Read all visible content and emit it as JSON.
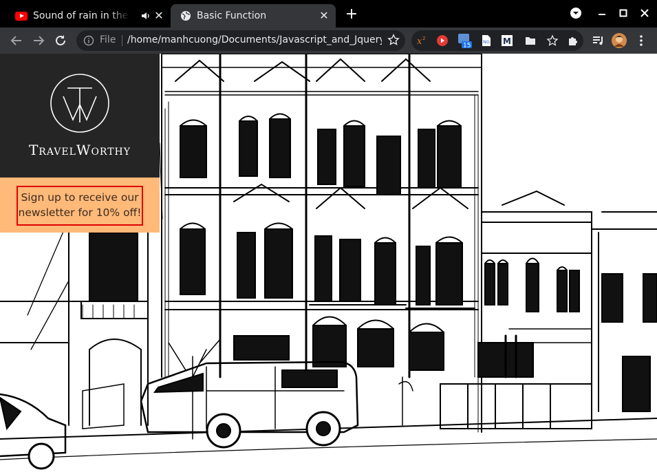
{
  "browser": {
    "tabs": [
      {
        "title": "Sound of rain in the dee",
        "favicon": "youtube-icon",
        "audio": "speaker-icon",
        "active": false
      },
      {
        "title": "Basic Function",
        "favicon": "globe-icon",
        "active": true
      }
    ],
    "address": {
      "scheme_label": "File",
      "url": "/home/manhcuong/Documents/Javascript_and_Jquery/..."
    },
    "extension_badge": "15"
  },
  "page": {
    "brand": {
      "name": "TravelWorthy",
      "logo_monogram": "TW"
    },
    "promo": {
      "text": "Sign up to receive our newsletter for 10% off!"
    },
    "background": "hand-drawn sketch of victorian row houses with a parked van"
  },
  "colors": {
    "tabstrip": "#000000",
    "toolbar": "#35363a",
    "brand_panel": "#252525",
    "promo_bg": "#ffb979",
    "promo_border": "#e00000"
  }
}
